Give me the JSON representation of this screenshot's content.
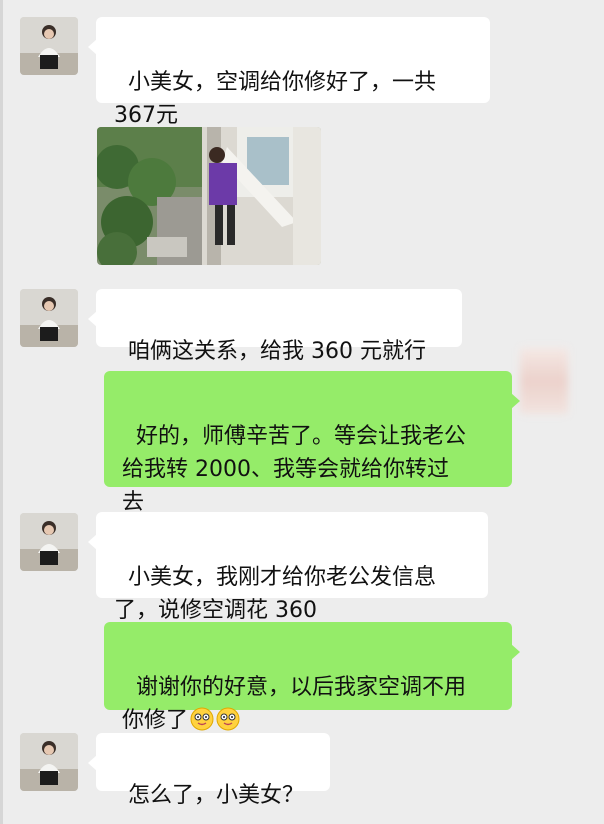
{
  "chat": {
    "messages": [
      {
        "side": "in",
        "text": "小美女，空调给你修好了，一共\n367元"
      },
      {
        "side": "in",
        "type": "image",
        "image_icon": "photo-worker-on-window-ledge"
      },
      {
        "side": "in",
        "text": "咱俩这关系，给我 360 元就行"
      },
      {
        "side": "out",
        "text": "好的，师傅辛苦了。等会让我老公\n给我转 2000、我等会就给你转过\n去"
      },
      {
        "side": "in",
        "text": "小美女，我刚才给你老公发信息\n了，说修空调花 360"
      },
      {
        "side": "out",
        "text": "谢谢你的好意，以后我家空调不用\n你修了",
        "emoji": [
          "smile-emoji",
          "smile-emoji"
        ]
      },
      {
        "side": "in",
        "text": "怎么了，小美女？"
      }
    ]
  },
  "colors": {
    "background": "#ededed",
    "incoming_bubble": "#ffffff",
    "outgoing_bubble": "#95ec69"
  }
}
